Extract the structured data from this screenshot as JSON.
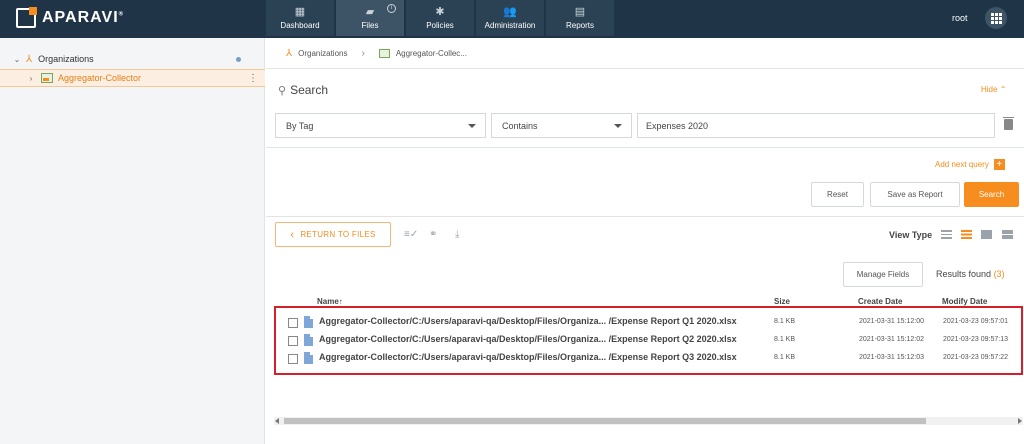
{
  "brand": {
    "name": "APARAVI",
    "trademark": "®"
  },
  "nav": {
    "items": [
      {
        "label": "Dashboard",
        "icon": "dashboard-icon",
        "glyph": "▦"
      },
      {
        "label": "Files",
        "icon": "folder-icon",
        "glyph": "▰",
        "active": true,
        "info": "i"
      },
      {
        "label": "Policies",
        "icon": "gear-icon",
        "glyph": "✱"
      },
      {
        "label": "Administration",
        "icon": "users-icon",
        "glyph": "👥"
      },
      {
        "label": "Reports",
        "icon": "clipboard-icon",
        "glyph": "▤"
      }
    ]
  },
  "user": {
    "name": "root"
  },
  "sidebar": {
    "tree": [
      {
        "label": "Organizations",
        "chevron": "⌄",
        "icon": "organization-icon"
      },
      {
        "label": "Aggregator-Collector",
        "chevron": "›",
        "icon": "aggregator-icon",
        "selected": true
      }
    ],
    "kebab": "⋮"
  },
  "breadcrumb": {
    "items": [
      "Organizations",
      "Aggregator-Collec..."
    ],
    "separator": "›"
  },
  "search": {
    "title": "Search",
    "hide_label": "Hide",
    "hide_chevron": "⌃",
    "filter_by": "By Tag",
    "operator": "Contains",
    "value": "Expenses 2020",
    "add_query": "Add next query",
    "add_query_plus": "+",
    "reset": "Reset",
    "save_report": "Save as Report",
    "search_button": "Search"
  },
  "toolbar": {
    "return_label": "RETURN TO FILES",
    "return_chevron": "‹",
    "view_type_label": "View Type",
    "manage_fields": "Manage Fields",
    "results_label": "Results found",
    "results_count": "(3)"
  },
  "table": {
    "columns": {
      "name": "Name",
      "sort_arrow": "↑",
      "size": "Size",
      "create": "Create Date",
      "modify": "Modify Date"
    },
    "rows": [
      {
        "name": "Aggregator-Collector/C:/Users/aparavi-qa/Desktop/Files/Organiza... /Expense Report Q1 2020.xlsx",
        "size": "8.1 KB",
        "created": "2021-03-31 15:12:00",
        "modified": "2021-03-23 09:57:01"
      },
      {
        "name": "Aggregator-Collector/C:/Users/aparavi-qa/Desktop/Files/Organiza... /Expense Report Q2 2020.xlsx",
        "size": "8.1 KB",
        "created": "2021-03-31 15:12:02",
        "modified": "2021-03-23 09:57:13"
      },
      {
        "name": "Aggregator-Collector/C:/Users/aparavi-qa/Desktop/Files/Organiza... /Expense Report Q3 2020.xlsx",
        "size": "8.1 KB",
        "created": "2021-03-31 15:12:03",
        "modified": "2021-03-23 09:57:22"
      }
    ]
  },
  "colors": {
    "accent": "#f68d1e",
    "topbar": "#1f3447",
    "highlight_border": "#d3202a"
  }
}
